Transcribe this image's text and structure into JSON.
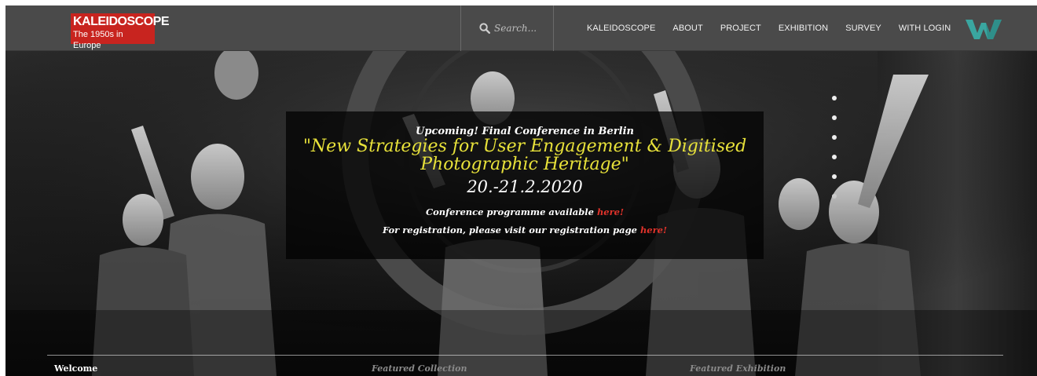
{
  "header": {
    "logo": {
      "title": "KALEIDOSCOPE",
      "subtitle": "The 1950s in Europe"
    },
    "search": {
      "placeholder": "Search...",
      "value": ""
    },
    "nav": [
      {
        "label": "KALEIDOSCOPE"
      },
      {
        "label": "ABOUT"
      },
      {
        "label": "PROJECT"
      },
      {
        "label": "EXHIBITION"
      },
      {
        "label": "SURVEY"
      },
      {
        "label": "WITH LOGIN"
      }
    ],
    "brand_icon": "w-logo-icon"
  },
  "hero": {
    "image": "black-and-white photo of dancers performing",
    "promo": {
      "upcoming": "Upcoming! Final Conference in Berlin",
      "title": "\"New Strategies for User Engagement & Digitised Photographic Heritage\"",
      "date": "20.-21.2.2020",
      "programme_text": "Conference programme available ",
      "programme_link": "here!",
      "registration_text": "For registration, please visit our registration page ",
      "registration_link": "here!"
    },
    "tabs": [
      {
        "label": "Welcome",
        "active": true
      },
      {
        "label": "Featured Collection",
        "active": false
      },
      {
        "label": "Featured Exhibition",
        "active": false
      }
    ]
  },
  "colors": {
    "header_bg": "#4a4a4a",
    "logo_bg": "#c8241f",
    "title_yellow": "#e8e23a",
    "link_red": "#e0332b",
    "brand_teal": "#3aa6a0"
  }
}
